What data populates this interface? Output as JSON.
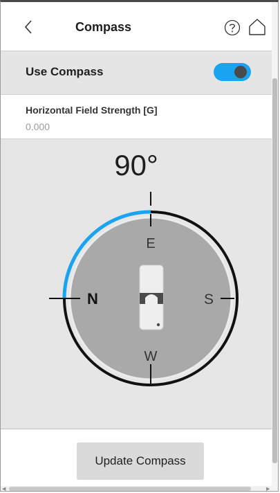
{
  "header": {
    "title": "Compass",
    "back_icon": "chevron-left-icon",
    "help_icon": "help-circle-icon",
    "home_icon": "home-icon"
  },
  "toggle": {
    "label": "Use Compass",
    "enabled": true,
    "on_color": "#1aa3ee"
  },
  "field": {
    "label": "Horizontal Field Strength [G]",
    "value": "0.000"
  },
  "compass": {
    "heading_label": "90°",
    "heading_degrees": 90,
    "direction_labels": {
      "top": "E",
      "left": "N",
      "right": "S",
      "bottom": "W"
    },
    "arc_color": "#1aa3ee",
    "dial_color": "#a9a9a9"
  },
  "footer": {
    "update_label": "Update Compass"
  }
}
